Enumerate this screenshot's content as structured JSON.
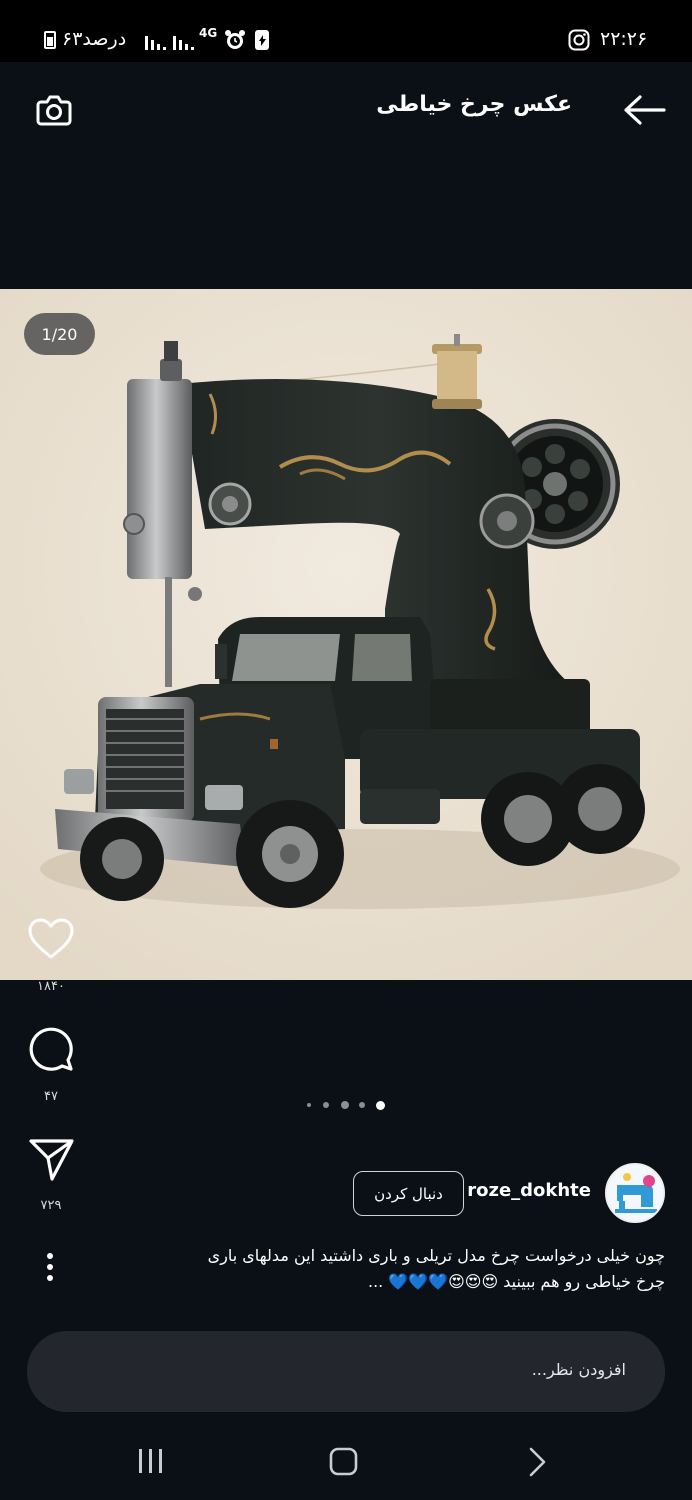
{
  "status_bar": {
    "time": "۲۲:۲۶",
    "battery": "۶۳درصد",
    "network": "4G"
  },
  "header": {
    "title": "عکس چرخ خیاطی"
  },
  "post": {
    "image_counter": "1/20",
    "likes": "۱۸۴۰",
    "comments": "۴۷",
    "shares": "۷۲۹",
    "carousel": {
      "total": 5,
      "active": 5
    },
    "username": "roze_dokhte",
    "follow_label": "دنبال کردن",
    "caption_line1": "چون خیلی  درخواست چرخ مدل تریلی و باری داشتید این مدلهای باری",
    "caption_line2": "چرخ خیاطی رو هم ببینید 😍😍😍💙💙💙 ..."
  },
  "comment_box": {
    "placeholder": "افزودن نظر..."
  },
  "colors": {
    "background": "#0b1017",
    "image_background": "#ebe3d5",
    "comment_bar": "#23272d"
  },
  "icons": [
    "back-arrow-icon",
    "camera-icon",
    "heart-icon",
    "comment-icon",
    "share-icon",
    "more-icon",
    "instagram-icon",
    "recent-apps-icon",
    "home-icon",
    "back-icon"
  ]
}
